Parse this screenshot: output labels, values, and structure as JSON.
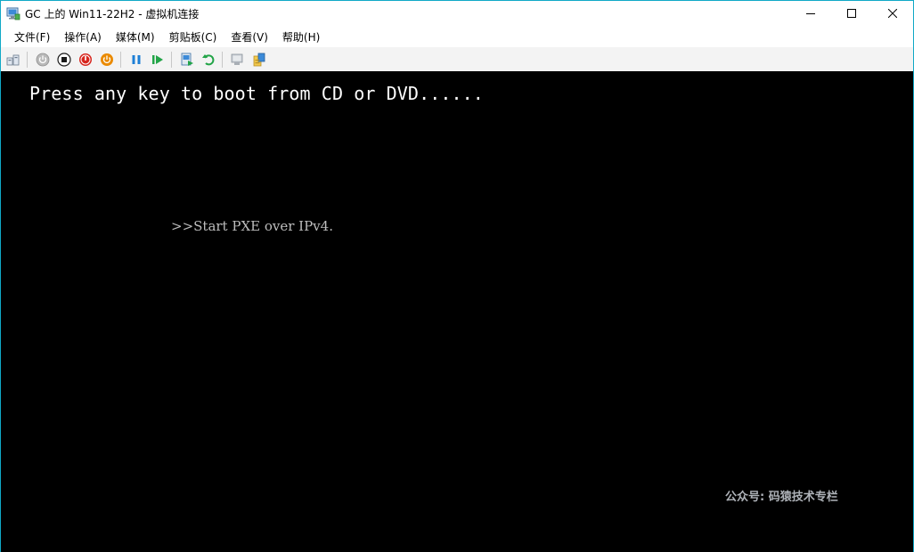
{
  "window": {
    "title": "GC 上的 Win11-22H2 - 虚拟机连接",
    "controls": [
      "minimize-icon",
      "maximize-icon",
      "close-icon"
    ]
  },
  "menu": [
    {
      "label": "文件(F)"
    },
    {
      "label": "操作(A)"
    },
    {
      "label": "媒体(M)"
    },
    {
      "label": "剪贴板(C)"
    },
    {
      "label": "查看(V)"
    },
    {
      "label": "帮助(H)"
    }
  ],
  "toolbar": {
    "buttons": [
      "ctrl-alt-del-icon",
      "start-icon",
      "turn-off-icon",
      "shut-down-icon",
      "save-icon",
      "pause-icon",
      "resume-icon",
      "checkpoint-icon",
      "revert-icon",
      "enhanced-session-icon",
      "share-icon"
    ],
    "colors": {
      "red": "#d7261e",
      "orange": "#ea8a00",
      "blue": "#1e7fd6",
      "green": "#22a447"
    }
  },
  "screen": {
    "boot_message": "Press any key to boot from CD or DVD......",
    "pxe_message": ">>Start PXE over IPv4.",
    "watermark": "公众号: 码猿技术专栏"
  }
}
